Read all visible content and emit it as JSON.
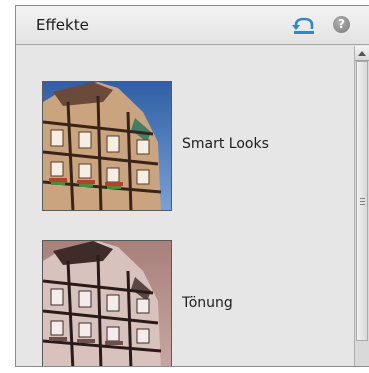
{
  "panel": {
    "title": "Effekte",
    "reset_icon": "reset-arrow-icon",
    "help_icon": "question-mark-icon",
    "help_glyph": "?"
  },
  "effects": [
    {
      "label": "Smart Looks",
      "thumbnail": "half-timbered-house-color"
    },
    {
      "label": "Tönung",
      "thumbnail": "half-timbered-house-tinted"
    }
  ],
  "colors": {
    "accent": "#2f86c9",
    "tint": "#b58a86"
  }
}
